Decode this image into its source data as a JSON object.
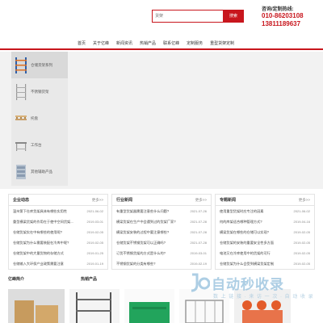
{
  "header": {
    "search_placeholder": "货架",
    "search_button": "搜索",
    "hotline_label": "咨询/定制热线:",
    "hotline_phone_1": "010-86203108",
    "hotline_phone_2": "13811189637"
  },
  "nav": [
    "首页",
    "关于亿峰",
    "新闻资讯",
    "热销产品",
    "联系亿峰",
    "定制服务",
    "重型货架定制"
  ],
  "categories": [
    "仓储货架系列",
    "不锈钢货架",
    "托盘",
    "工作台",
    "其他辅助产品"
  ],
  "sections": {
    "company_news": {
      "title": "企业动态",
      "more": "更多>>",
      "items": [
        {
          "text": "温州第下仓库货架具体有哪些实用性",
          "date": "2021-06-02"
        },
        {
          "text": "重型横梁货架的作用在于使中空间货架...",
          "date": "2019-03-01"
        },
        {
          "text": "仓储货架实在中有哪些的使用呢?",
          "date": "2019-02-05"
        },
        {
          "text": "仓储货架为什么需要装配在冷库中呢?",
          "date": "2019-02-05"
        },
        {
          "text": "仓储货架中的大量货物的存储方式",
          "date": "2019-01-25"
        },
        {
          "text": "仓储输入大环保产业政策需要注意",
          "date": "2019-01-19"
        }
      ]
    },
    "industry_news": {
      "title": "行业新闻",
      "more": "更多>>",
      "items": [
        {
          "text": "有重型货架器需要注意些什么问题?",
          "date": "2021-07-26"
        },
        {
          "text": "横梁货架在生产中会遇到过的货架厂家?",
          "date": "2021-07-28"
        },
        {
          "text": "横梁货架安装的过程中要注意哪些?",
          "date": "2021-07-28"
        },
        {
          "text": "仓储货架不锈钢货架可以正确吗?",
          "date": "2021-07-28"
        },
        {
          "text": "订货不锈钢货架的方式是什么的?",
          "date": "2019-03-01"
        },
        {
          "text": "不锈钢货架的分类有哪些?",
          "date": "2019-02-19"
        }
      ]
    },
    "special_news": {
      "title": "专题新闻",
      "more": "更多>>",
      "items": [
        {
          "text": "使用重型货架时应专注的因素",
          "date": "2021-06-02"
        },
        {
          "text": "何的库架适合哪种管理方式?",
          "date": "2019-04-16"
        },
        {
          "text": "横梁货架在哪些的仓储可以实现?",
          "date": "2019-02-05"
        },
        {
          "text": "仓储货架的安装的重要安全性多方面",
          "date": "2019-02-05"
        },
        {
          "text": "电池又在冷库使用中的货架的可行",
          "date": "2019-02-05"
        },
        {
          "text": "仓储货架为什么会受到横梁货架定制",
          "date": "2019-02-05"
        }
      ]
    }
  },
  "bottom": {
    "company_intro": "亿峰简介",
    "hot_products": "热销产品"
  },
  "watermark": {
    "title": "自动秒收录",
    "subtitle": "数 上 链 接 · 来 访 一 次 · 自 动 收 录"
  },
  "colors": {
    "accent": "#c8161d",
    "banner": "#f2f2f2"
  }
}
